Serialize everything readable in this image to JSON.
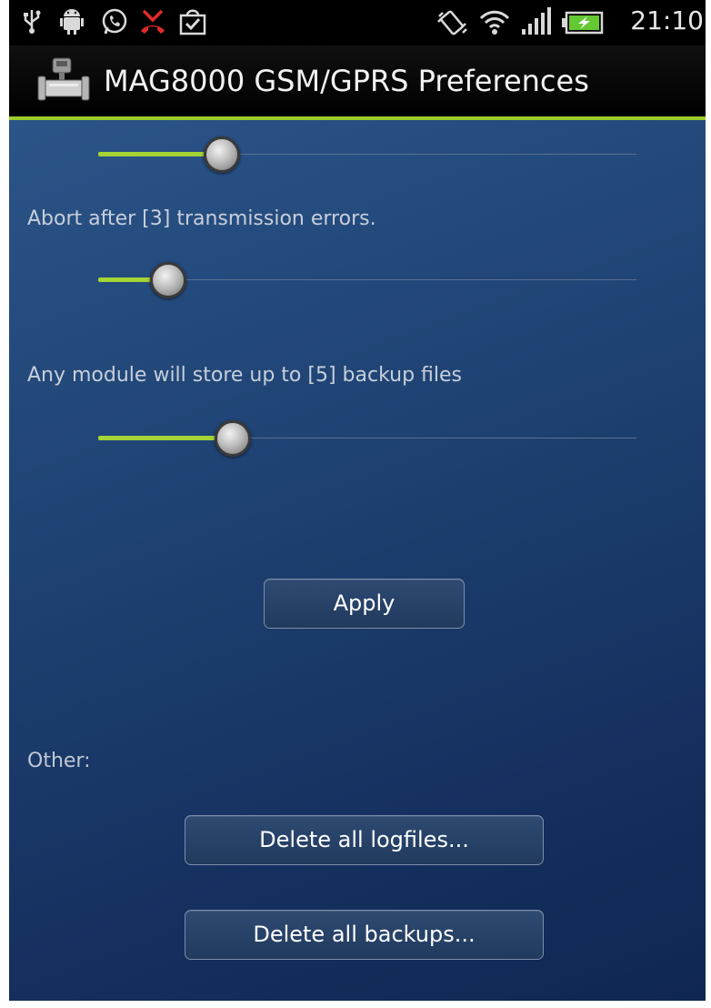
{
  "status_bar": {
    "time": "21:10",
    "icons": [
      "usb-icon",
      "android-debug-icon",
      "whatsapp-icon",
      "missed-call-icon",
      "market-update-icon",
      "vibrate-icon",
      "wifi-icon",
      "signal-icon",
      "battery-charging-icon"
    ]
  },
  "title_bar": {
    "title": "MAG8000 GSM/GPRS Preferences",
    "icon": "flowmeter-icon"
  },
  "preferences": {
    "sliders": [
      {
        "label": "",
        "progress": 0.23
      },
      {
        "label": "Abort after [3] transmission errors.",
        "progress": 0.13
      },
      {
        "label": "Any module will store up to [5] backup files",
        "progress": 0.25
      }
    ]
  },
  "buttons": {
    "apply": "Apply",
    "delete_logfiles": "Delete all logfiles...",
    "delete_backups": "Delete all backups..."
  },
  "other_section": {
    "label": "Other:"
  },
  "colors": {
    "accent": "#a5d436",
    "background": "#1e4272",
    "title_bar": "#000000"
  }
}
